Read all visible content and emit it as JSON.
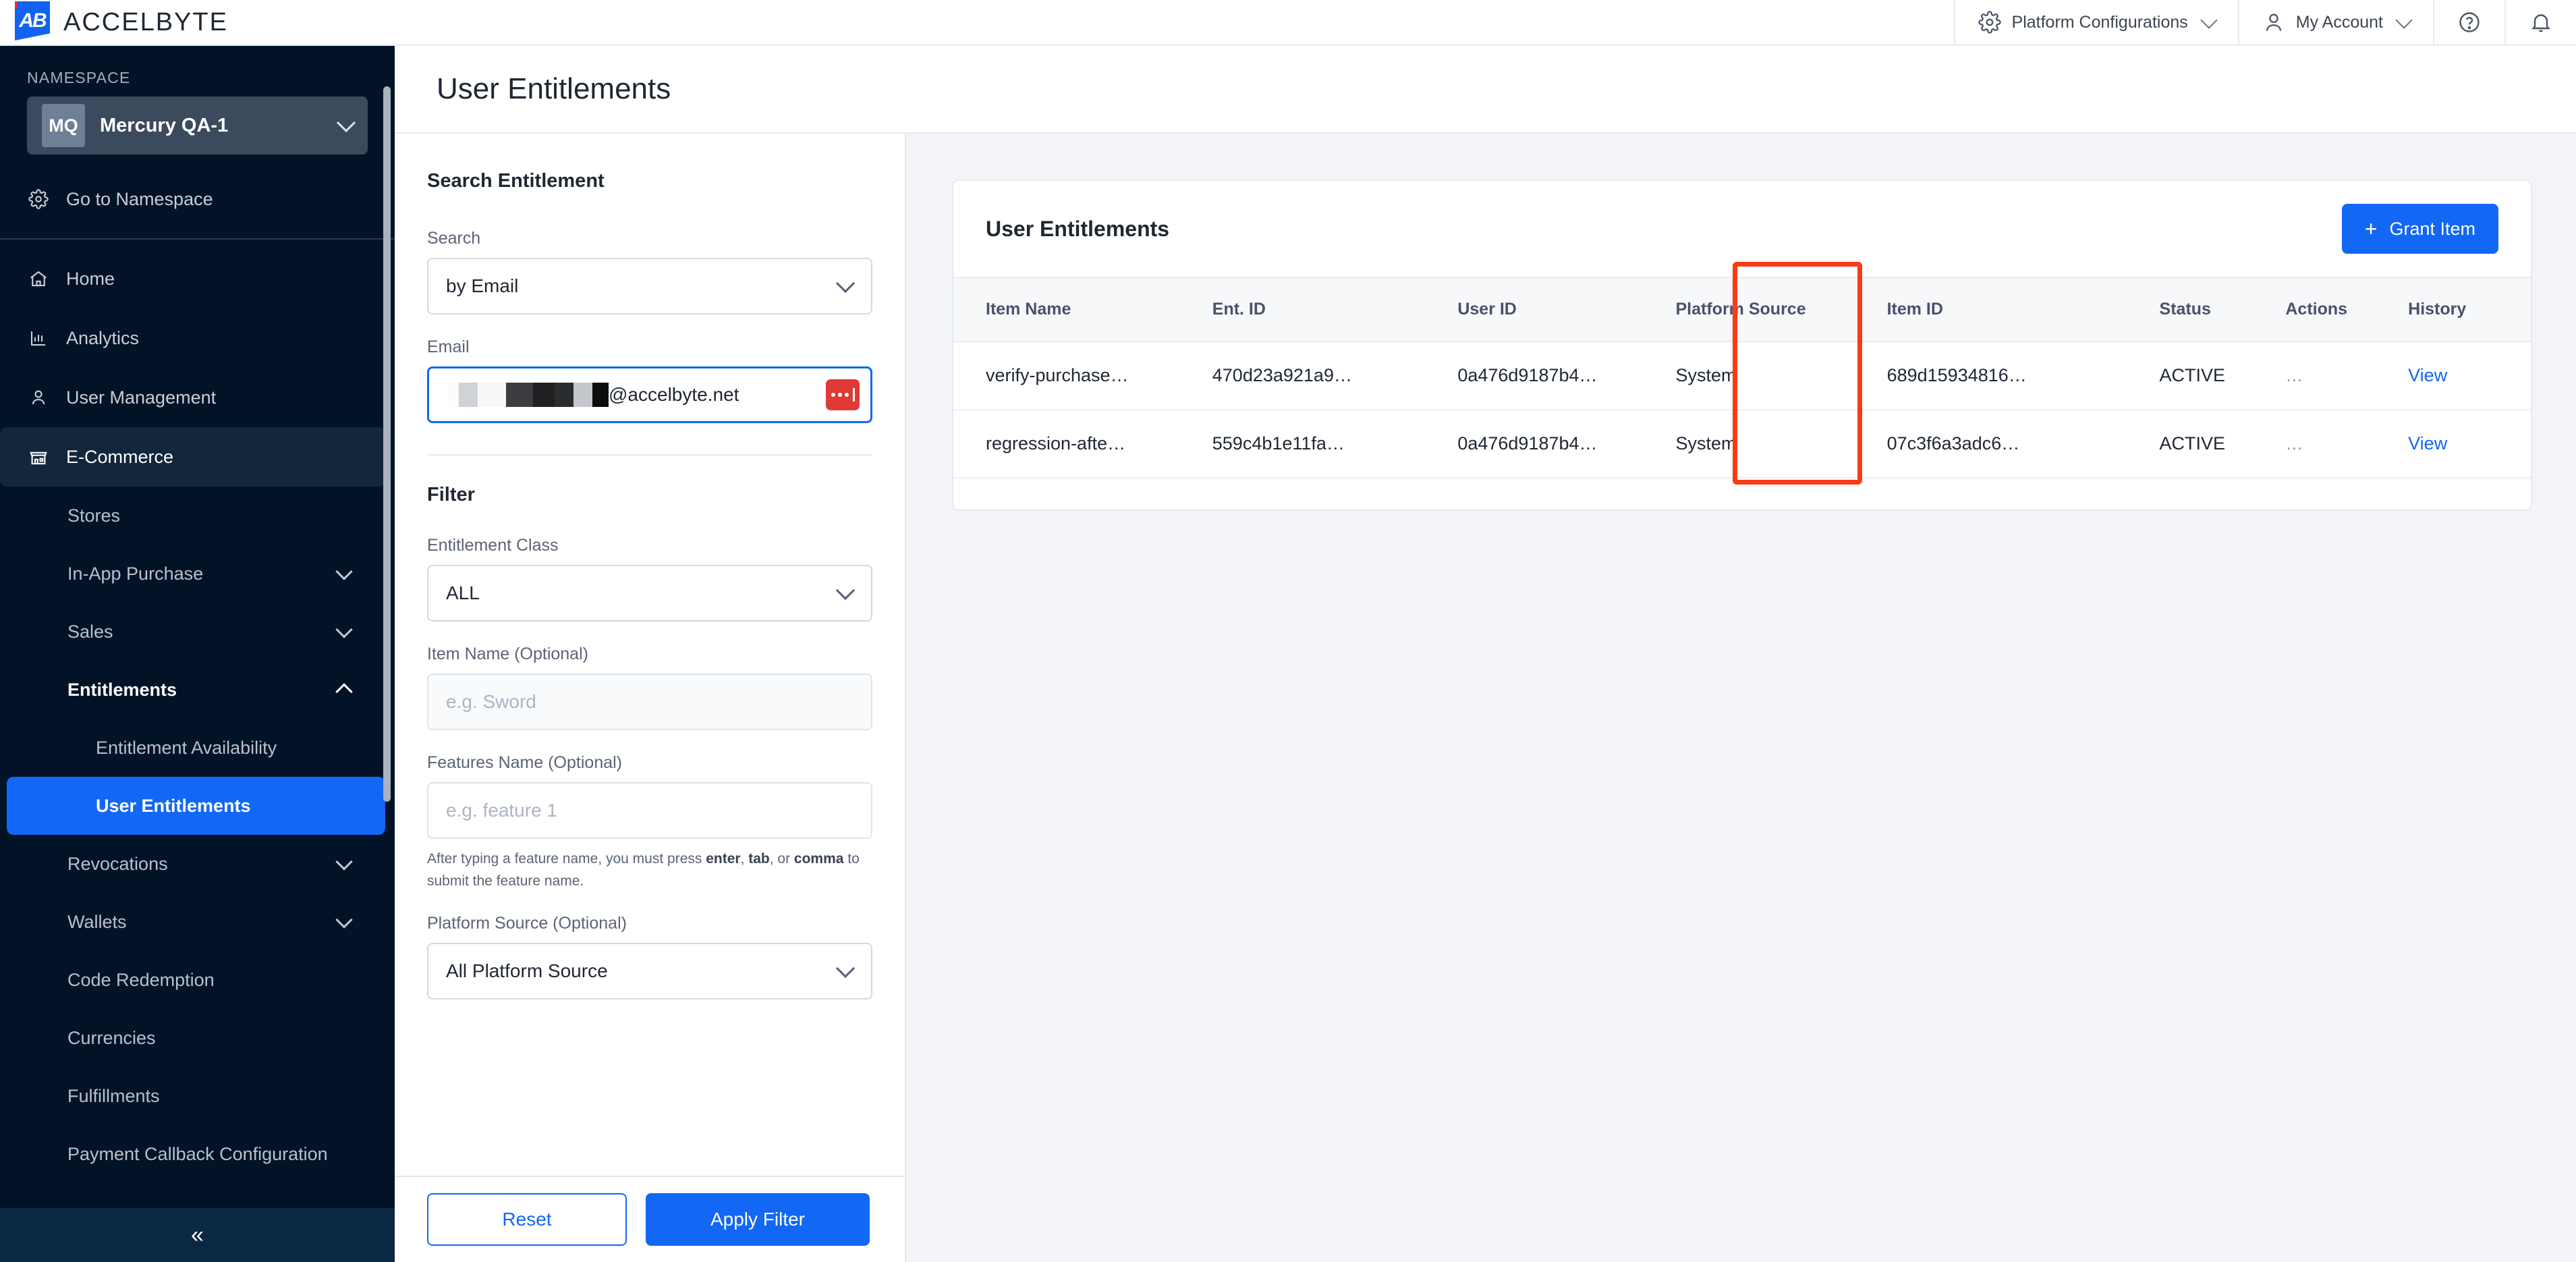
{
  "brand": {
    "name": "ACCELBYTE",
    "monogram": "AB"
  },
  "topbar": {
    "platform_configurations": "Platform Configurations",
    "my_account": "My Account",
    "help_icon": "help-circle-icon",
    "bell_icon": "notification-bell-icon",
    "gear_icon": "gear-icon",
    "person_icon": "person-icon"
  },
  "sidebar": {
    "namespace_label": "NAMESPACE",
    "namespace_badge": "MQ",
    "namespace_name": "Mercury QA-1",
    "go_to_namespace": "Go to Namespace",
    "items": [
      {
        "label": "Home",
        "icon": "home-icon"
      },
      {
        "label": "Analytics",
        "icon": "bar-chart-icon"
      },
      {
        "label": "User Management",
        "icon": "person-icon"
      },
      {
        "label": "E-Commerce",
        "icon": "store-icon"
      }
    ],
    "ecommerce_children": [
      {
        "label": "Stores",
        "expandable": false
      },
      {
        "label": "In-App Purchase",
        "expandable": true
      },
      {
        "label": "Sales",
        "expandable": true
      },
      {
        "label": "Entitlements",
        "expandable": true,
        "expanded": true
      },
      {
        "label": "Revocations",
        "expandable": true
      },
      {
        "label": "Wallets",
        "expandable": true
      },
      {
        "label": "Code Redemption",
        "expandable": false
      },
      {
        "label": "Currencies",
        "expandable": false
      },
      {
        "label": "Fulfillments",
        "expandable": false
      },
      {
        "label": "Payment Callback Configuration",
        "expandable": false
      }
    ],
    "entitlement_children": [
      {
        "label": "Entitlement Availability",
        "selected": false
      },
      {
        "label": "User Entitlements",
        "selected": true
      }
    ],
    "collapse_icon": "double-chevron-left-icon"
  },
  "page": {
    "title": "User Entitlements"
  },
  "search_panel": {
    "heading": "Search Entitlement",
    "search_label": "Search",
    "search_value": "by Email",
    "email_label": "Email",
    "email_value_suffix": "@accelbyte.net",
    "password_manager_icon": "password-manager-icon",
    "filter_heading": "Filter",
    "entitlement_class_label": "Entitlement Class",
    "entitlement_class_value": "ALL",
    "item_name_label": "Item Name (Optional)",
    "item_name_placeholder": "e.g. Sword",
    "features_name_label": "Features Name (Optional)",
    "features_name_placeholder": "e.g. feature 1",
    "features_hint_1": "After typing a feature name, you must press ",
    "features_hint_enter": "enter",
    "features_hint_2": ", ",
    "features_hint_tab": "tab",
    "features_hint_3": ", or ",
    "features_hint_comma": "comma",
    "features_hint_4": " to submit the feature name.",
    "platform_source_label": "Platform Source (Optional)",
    "platform_source_value": "All Platform Source",
    "reset_label": "Reset",
    "apply_label": "Apply Filter"
  },
  "table": {
    "card_title": "User Entitlements",
    "grant_item_label": "Grant Item",
    "columns": [
      "Item Name",
      "Ent. ID",
      "User ID",
      "Platform Source",
      "Item ID",
      "Status",
      "Actions",
      "History"
    ],
    "rows": [
      {
        "item_name": "verify-purchase…",
        "ent_id": "470d23a921a9…",
        "user_id": "0a476d9187b4…",
        "platform_source": "System",
        "item_id": "689d15934816…",
        "status": "ACTIVE",
        "actions": "…",
        "history": "View"
      },
      {
        "item_name": "regression-afte…",
        "ent_id": "559c4b1e11fa…",
        "user_id": "0a476d9187b4…",
        "platform_source": "System",
        "item_id": "07c3f6a3adc6…",
        "status": "ACTIVE",
        "actions": "…",
        "history": "View"
      }
    ]
  },
  "annotation": {
    "highlight_color": "#f93c16",
    "highlighted_column": "Platform Source"
  },
  "colors": {
    "accent": "#1267f5",
    "sidebar_bg": "#021327",
    "danger": "#e03a36",
    "content_bg": "#f2f4f7"
  }
}
